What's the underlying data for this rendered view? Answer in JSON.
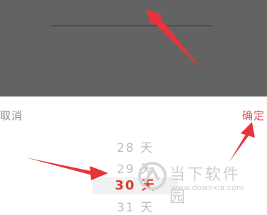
{
  "toolbar": {
    "cancel_label": "取消",
    "confirm_label": "确定"
  },
  "picker": {
    "items": [
      "28 天",
      "29 天",
      "30 天",
      "31 天"
    ],
    "selected": "30 天"
  },
  "watermark": {
    "name": "当下软件园",
    "url": "www.downxia.com"
  },
  "colors": {
    "accent": "#e8505b",
    "selected": "#d8402a",
    "overlay": "#636363",
    "arrow": "#e8333a"
  }
}
